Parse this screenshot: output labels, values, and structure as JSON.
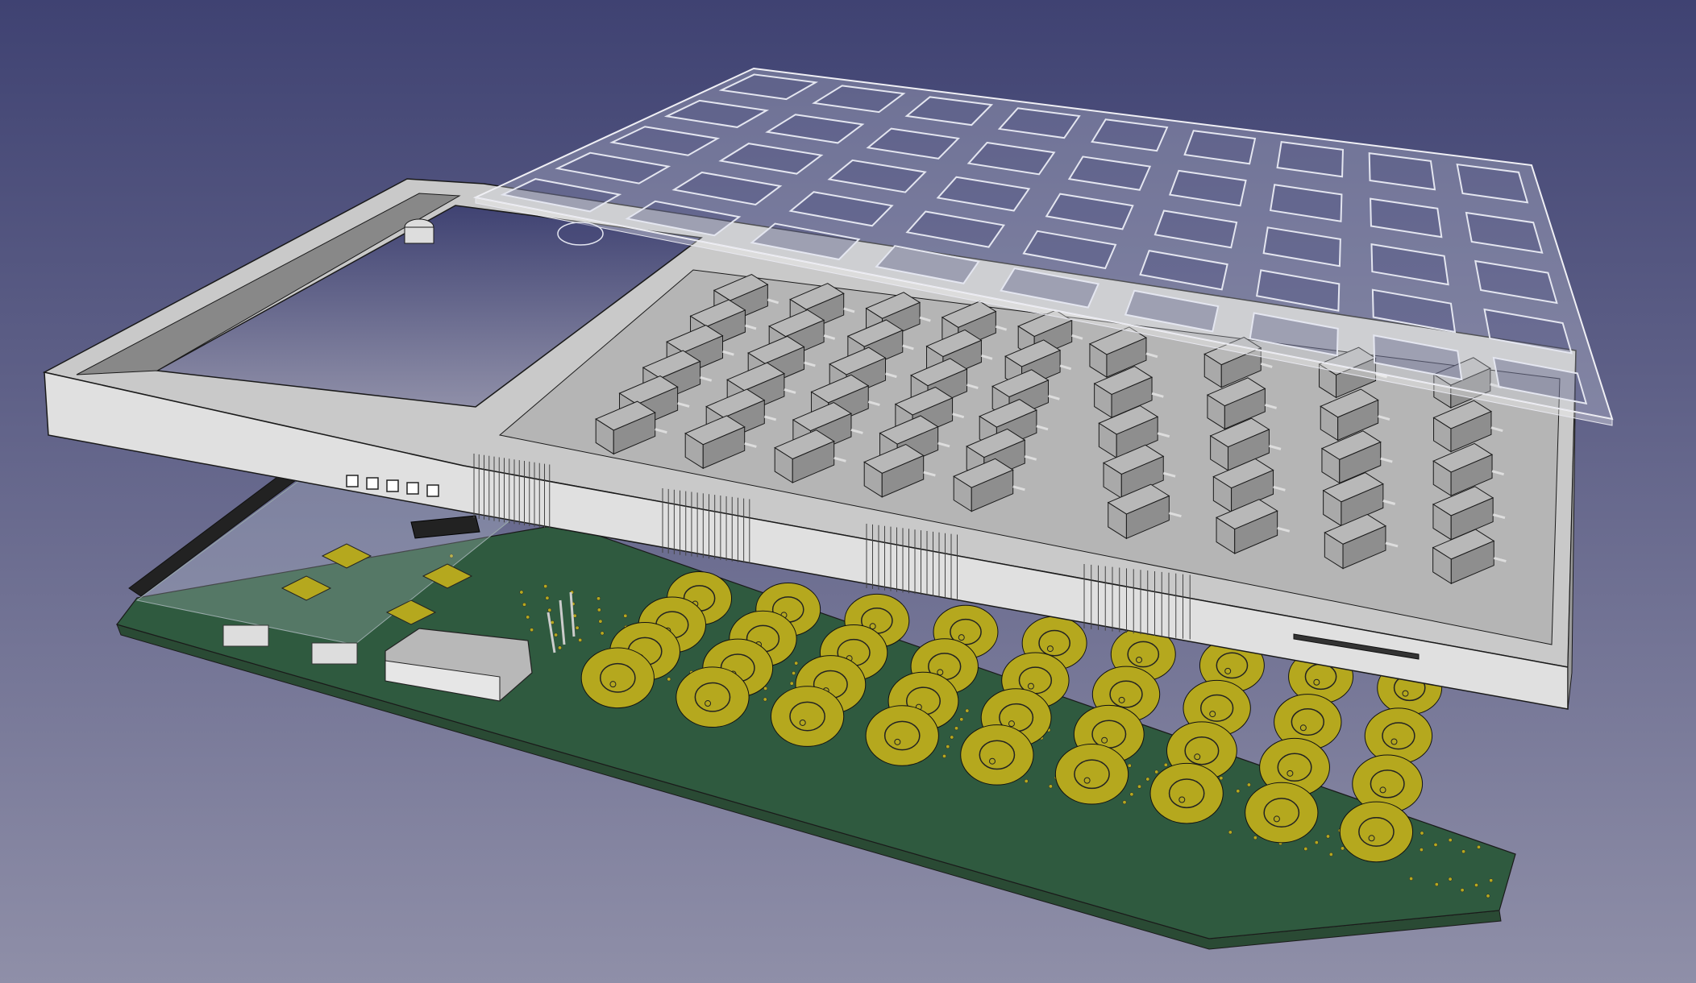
{
  "viewport": {
    "background_top": "#3f4272",
    "background_bottom": "#8f8fa8"
  },
  "colors": {
    "pcb": "#2f5a3f",
    "pcb_edge": "#2a4a34",
    "pad_gold": "#b5a81e",
    "pad_gold_dark": "#8a7f10",
    "housing": "#c9c9c9",
    "housing_front": "#e0e0e0",
    "housing_shadow": "#9a9a9a",
    "key": "#a9a9a9",
    "key_top": "#b8b8b8",
    "overlay": "#d9dbe6",
    "edge": "#1a1a1a"
  },
  "model": {
    "parts": [
      "pcb",
      "pads",
      "keys",
      "housing",
      "overlay"
    ],
    "key_grid": {
      "left_rows": 6,
      "left_cols": 5,
      "right_rows": 5,
      "right_cols": 4
    },
    "pad_grid": {
      "rows": 4,
      "cols": 5
    },
    "overlay_grid": {
      "rows": 5,
      "cols": 9
    }
  }
}
